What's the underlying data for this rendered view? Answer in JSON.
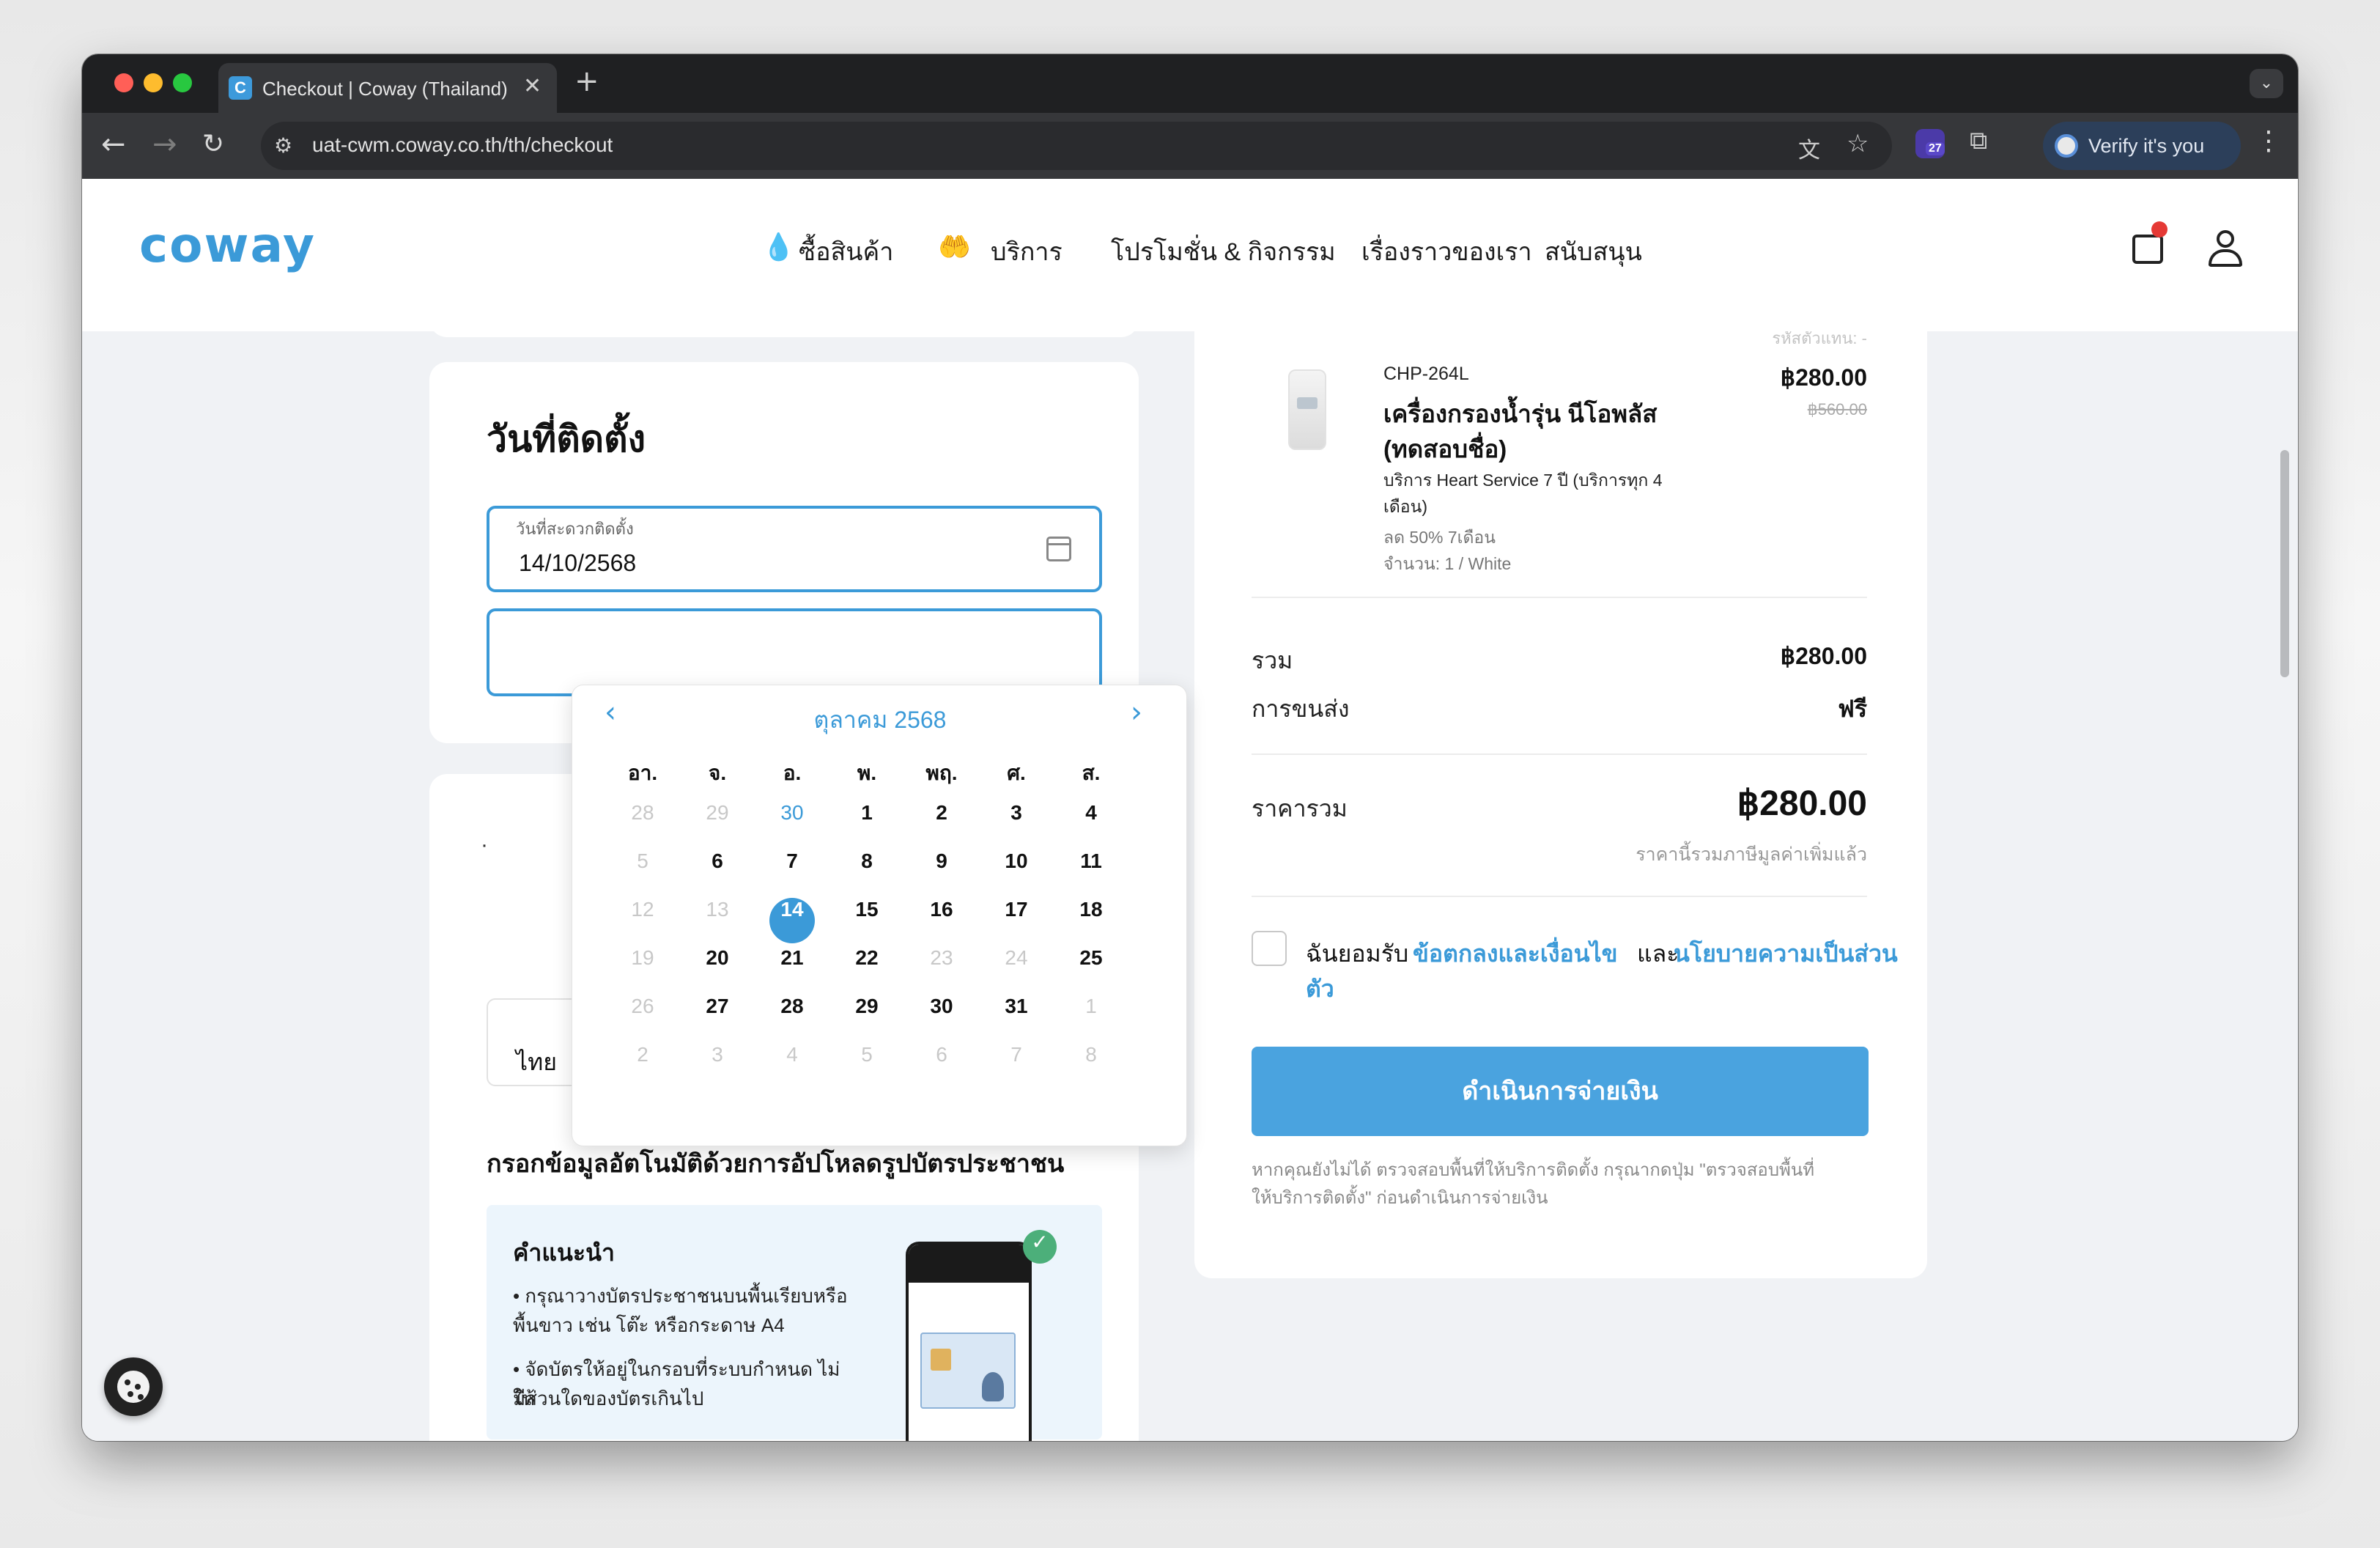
{
  "browser": {
    "tab_title": "Checkout | Coway (Thailand)",
    "tab_favicon": "C",
    "url": "uat-cwm.coway.co.th/th/checkout",
    "extension_badge": "27",
    "verify_label": "Verify it's you"
  },
  "site": {
    "logo": "coway",
    "nav": [
      "ซื้อสินค้า",
      "บริการ",
      "โปรโมชั่น & กิจกรรม",
      "เรื่องราวของเรา",
      "สนับสนุน"
    ]
  },
  "install": {
    "title": "วันที่ติดตั้ง",
    "date_label": "วันที่สะดวกติดตั้ง",
    "date_value": "14/10/2568"
  },
  "calendar": {
    "month_label": "ตุลาคม 2568",
    "weekdays": [
      "อา.",
      "จ.",
      "อ.",
      "พ.",
      "พฤ.",
      "ศ.",
      "ส."
    ],
    "weeks": [
      [
        {
          "d": "28",
          "s": "muted"
        },
        {
          "d": "29",
          "s": "muted"
        },
        {
          "d": "30",
          "s": "today"
        },
        {
          "d": "1",
          "s": ""
        },
        {
          "d": "2",
          "s": ""
        },
        {
          "d": "3",
          "s": ""
        },
        {
          "d": "4",
          "s": ""
        }
      ],
      [
        {
          "d": "5",
          "s": "muted"
        },
        {
          "d": "6",
          "s": ""
        },
        {
          "d": "7",
          "s": ""
        },
        {
          "d": "8",
          "s": ""
        },
        {
          "d": "9",
          "s": ""
        },
        {
          "d": "10",
          "s": ""
        },
        {
          "d": "11",
          "s": ""
        }
      ],
      [
        {
          "d": "12",
          "s": "muted"
        },
        {
          "d": "13",
          "s": "muted"
        },
        {
          "d": "14",
          "s": "sel"
        },
        {
          "d": "15",
          "s": ""
        },
        {
          "d": "16",
          "s": ""
        },
        {
          "d": "17",
          "s": ""
        },
        {
          "d": "18",
          "s": ""
        }
      ],
      [
        {
          "d": "19",
          "s": "muted"
        },
        {
          "d": "20",
          "s": ""
        },
        {
          "d": "21",
          "s": ""
        },
        {
          "d": "22",
          "s": ""
        },
        {
          "d": "23",
          "s": "muted"
        },
        {
          "d": "24",
          "s": "muted"
        },
        {
          "d": "25",
          "s": ""
        }
      ],
      [
        {
          "d": "26",
          "s": "muted"
        },
        {
          "d": "27",
          "s": ""
        },
        {
          "d": "28",
          "s": ""
        },
        {
          "d": "29",
          "s": ""
        },
        {
          "d": "30",
          "s": ""
        },
        {
          "d": "31",
          "s": ""
        },
        {
          "d": "1",
          "s": "muted"
        }
      ],
      [
        {
          "d": "2",
          "s": "muted"
        },
        {
          "d": "3",
          "s": "muted"
        },
        {
          "d": "4",
          "s": "muted"
        },
        {
          "d": "5",
          "s": "muted"
        },
        {
          "d": "6",
          "s": "muted"
        },
        {
          "d": "7",
          "s": "muted"
        },
        {
          "d": "8",
          "s": "muted"
        }
      ]
    ]
  },
  "address": {
    "province_value": "ไทย",
    "upload_title": "กรอกข้อมูลอัตโนมัติด้วยการอัปโหลดรูปบัตรประชาชน",
    "tips_title": "คำแนะนำ",
    "tips": [
      "• กรุณาวางบัตรประชาชนบนพื้นเรียบหรือ",
      "   พื้นขาว เช่น โต๊ะ หรือกระดาษ A4",
      "• จัดบัตรให้อยู่ในกรอบที่ระบบกำหนด ไม่ให้",
      "   มีส่วนใดของบัตรเกินไป"
    ]
  },
  "summary": {
    "cut_top": "รหัสตัวแทน: -",
    "sku": "CHP-264L",
    "name_line1": "เครื่องกรองน้ำรุ่น นีโอพลัส",
    "name_line2": "(ทดสอบชื่อ)",
    "service_line1": "บริการ Heart Service 7 ปี (บริการทุก 4",
    "service_line2": "เดือน)",
    "discount": "ลด 50% 7เดือน",
    "qty": "จำนวน: 1 / White",
    "price": "฿280.00",
    "old_price": "฿560.00",
    "subtotal_label": "รวม",
    "subtotal_value": "฿280.00",
    "shipping_label": "การขนส่ง",
    "shipping_value": "ฟรี",
    "total_label": "ราคารวม",
    "total_value": "฿280.00",
    "vat_note": "ราคานี้รวมภาษีมูลค่าเพิ่มแล้ว",
    "agree_prefix": "ฉันยอมรับ",
    "agree_terms": "ข้อตกลงและเงื่อนไข",
    "agree_and": "และ",
    "agree_privacy1": "นโยบายความเป็นส่วน",
    "agree_privacy2": "ตัว",
    "pay_button": "ดำเนินการจ่ายเงิน",
    "note_line1": "หากคุณยังไม่ได้ ตรวจสอบพื้นที่ให้บริการติดตั้ง กรุณากดปุ่ม \"ตรวจสอบพื้นที่",
    "note_line2": "ให้บริการติดตั้ง\" ก่อนดำเนินการจ่ายเงิน"
  },
  "colors": {
    "brand": "#3b9ad8",
    "button": "#4aa3df",
    "background": "#f0f2f5"
  }
}
